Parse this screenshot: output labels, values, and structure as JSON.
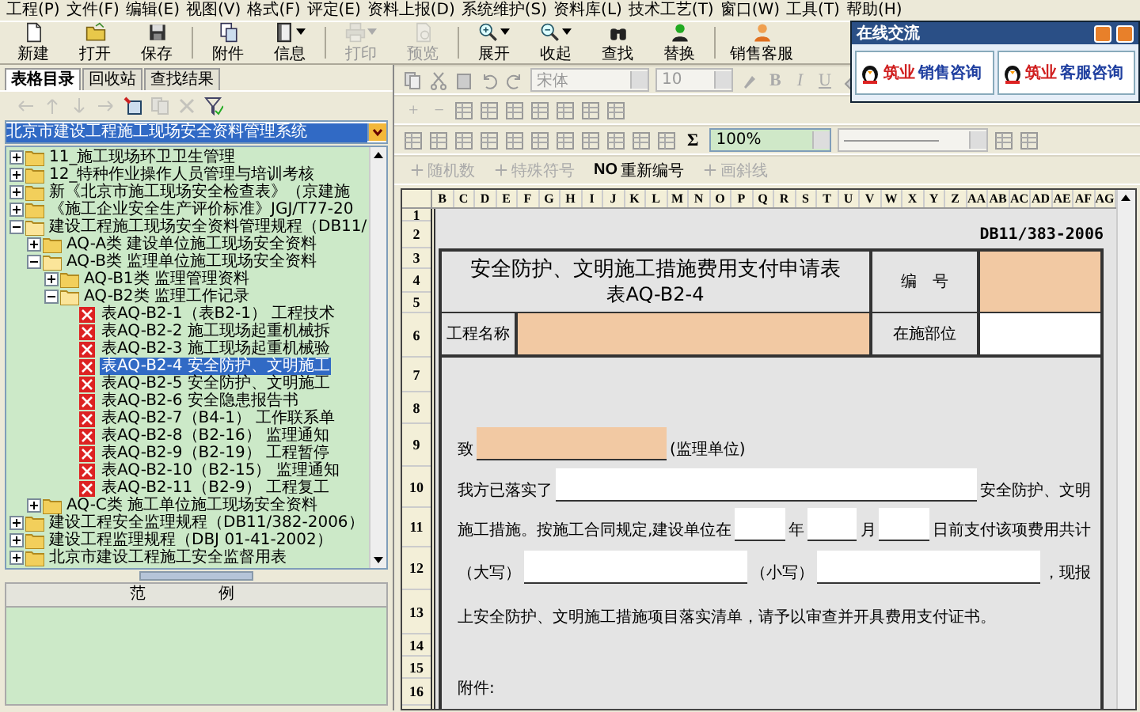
{
  "menu": [
    "工程(P)",
    "文件(F)",
    "编辑(E)",
    "视图(V)",
    "格式(F)",
    "评定(E)",
    "资料上报(D)",
    "系统维护(S)",
    "资料库(L)",
    "技术工艺(T)",
    "窗口(W)",
    "工具(T)",
    "帮助(H)"
  ],
  "toolbar": {
    "buttons": [
      {
        "label": "新建",
        "disabled": false,
        "has_menu": false
      },
      {
        "label": "打开",
        "disabled": false,
        "has_menu": false
      },
      {
        "label": "保存",
        "disabled": false,
        "has_menu": false
      },
      {
        "label": "附件",
        "disabled": false,
        "has_menu": false
      },
      {
        "label": "信息",
        "disabled": false,
        "has_menu": true
      },
      {
        "label": "打印",
        "disabled": true,
        "has_menu": true
      },
      {
        "label": "预览",
        "disabled": true,
        "has_menu": false
      },
      {
        "label": "展开",
        "disabled": false,
        "has_menu": true
      },
      {
        "label": "收起",
        "disabled": false,
        "has_menu": true
      },
      {
        "label": "查找",
        "disabled": false,
        "has_menu": false
      },
      {
        "label": "替换",
        "disabled": false,
        "has_menu": false
      },
      {
        "label": "销售客服",
        "disabled": false,
        "has_menu": false
      }
    ]
  },
  "chat_window": {
    "title": "在线交流",
    "buttons": [
      {
        "brand": "筑业",
        "label": "销售咨询"
      },
      {
        "brand": "筑业",
        "label": "客服咨询"
      }
    ]
  },
  "left_panel": {
    "tabs": [
      {
        "label": "表格目录",
        "selected": true
      },
      {
        "label": "回收站",
        "selected": false
      },
      {
        "label": "查找结果",
        "selected": false
      }
    ],
    "tree_toolbar": [
      {
        "disabled": true
      },
      {
        "disabled": true
      },
      {
        "disabled": true
      },
      {
        "disabled": true
      },
      {
        "disabled": false
      },
      {
        "disabled": true
      },
      {
        "disabled": true
      },
      {
        "disabled": false
      }
    ],
    "system_select": {
      "value": "北京市建设工程施工现场安全资料管理系统"
    },
    "tree": [
      {
        "kind": "folder",
        "label": "11_施工现场环卫卫生管理",
        "expanded": false,
        "selected": false
      },
      {
        "kind": "folder",
        "label": "12_特种作业操作人员管理与培训考核",
        "expanded": false,
        "selected": false
      },
      {
        "kind": "folder",
        "label": "新《北京市施工现场安全检查表》（京建施",
        "expanded": false,
        "selected": false
      },
      {
        "kind": "folder",
        "label": "《施工企业安全生产评价标准》JGJ/T77-20",
        "expanded": false,
        "selected": false
      },
      {
        "kind": "folder",
        "label": "建设工程施工现场安全资料管理规程（DB11/",
        "expanded": true,
        "selected": false,
        "children": [
          {
            "kind": "folder",
            "label": "AQ-A类 建设单位施工现场安全资料",
            "expanded": false,
            "selected": false
          },
          {
            "kind": "folder",
            "label": "AQ-B类 监理单位施工现场安全资料",
            "expanded": true,
            "selected": false,
            "children": [
              {
                "kind": "folder",
                "label": "AQ-B1类 监理管理资料",
                "expanded": false,
                "selected": false
              },
              {
                "kind": "folder",
                "label": "AQ-B2类 监理工作记录",
                "expanded": true,
                "selected": false,
                "children": [
                  {
                    "kind": "form",
                    "label": "表AQ-B2-1（表B2-1） 工程技术",
                    "selected": false
                  },
                  {
                    "kind": "form",
                    "label": "表AQ-B2-2 施工现场起重机械拆",
                    "selected": false
                  },
                  {
                    "kind": "form",
                    "label": "表AQ-B2-3 施工现场起重机械验",
                    "selected": false
                  },
                  {
                    "kind": "form",
                    "label": "表AQ-B2-4 安全防护、文明施工",
                    "selected": true
                  },
                  {
                    "kind": "form",
                    "label": "表AQ-B2-5 安全防护、文明施工",
                    "selected": false
                  },
                  {
                    "kind": "form",
                    "label": "表AQ-B2-6 安全隐患报告书",
                    "selected": false
                  },
                  {
                    "kind": "form",
                    "label": "表AQ-B2-7（B4-1） 工作联系单",
                    "selected": false
                  },
                  {
                    "kind": "form",
                    "label": "表AQ-B2-8（B2-16） 监理通知",
                    "selected": false
                  },
                  {
                    "kind": "form",
                    "label": "表AQ-B2-9（B2-19） 工程暂停",
                    "selected": false
                  },
                  {
                    "kind": "form",
                    "label": "表AQ-B2-10（B2-15） 监理通知",
                    "selected": false
                  },
                  {
                    "kind": "form",
                    "label": "表AQ-B2-11（B2-9） 工程复工",
                    "selected": false
                  }
                ]
              }
            ]
          },
          {
            "kind": "folder",
            "label": "AQ-C类 施工单位施工现场安全资料",
            "expanded": false,
            "selected": false
          }
        ]
      },
      {
        "kind": "folder",
        "label": "建设工程安全监理规程（DB11/382-2006）",
        "expanded": false,
        "selected": false
      },
      {
        "kind": "folder",
        "label": "建设工程监理规程（DBJ 01-41-2002）",
        "expanded": false,
        "selected": false
      },
      {
        "kind": "folder",
        "label": "北京市建设工程施工安全监督用表",
        "expanded": false,
        "selected": false
      }
    ],
    "example_panel": {
      "title": "范　例"
    }
  },
  "format_toolbar": {
    "font": {
      "value": "宋体",
      "disabled": true
    },
    "size": {
      "value": "10",
      "disabled": true
    },
    "style_buttons": [
      {
        "label": "B",
        "disabled": true
      },
      {
        "label": "I",
        "disabled": true
      },
      {
        "label": "U",
        "disabled": true
      }
    ]
  },
  "edit_toolbar": {
    "buttons": [
      {
        "label": "+",
        "disabled": true
      },
      {
        "label": "−",
        "disabled": true
      }
    ]
  },
  "layout_toolbar": {
    "sum": {
      "label": "Σ"
    },
    "zoom": {
      "value": "100%"
    }
  },
  "tools_toolbar": [
    {
      "label": "随机数",
      "disabled": true
    },
    {
      "label": "特殊符号",
      "disabled": true
    },
    {
      "label": "重新编号",
      "icon_text": "NO",
      "disabled": false
    },
    {
      "label": "画斜线",
      "disabled": true
    }
  ],
  "sheet": {
    "columns": [
      "B",
      "C",
      "D",
      "E",
      "F",
      "G",
      "H",
      "I",
      "J",
      "K",
      "L",
      "M",
      "N",
      "O",
      "P",
      "Q",
      "R",
      "S",
      "T",
      "U",
      "V",
      "W",
      "X",
      "Y",
      "Z",
      "AA",
      "AB",
      "AC",
      "AD",
      "AE",
      "AF",
      "AG"
    ],
    "row_numbers": [
      "1",
      "2",
      "3",
      "4",
      "5",
      "6",
      "7",
      "8",
      "9",
      "10",
      "11",
      "12",
      "13",
      "14",
      "15",
      "16"
    ],
    "standard": "DB11/383-2006",
    "title": "安全防护、文明施工措施费用支付申请表",
    "subtitle": "表AQ-B2-4",
    "number_label": "编　号",
    "number_field": {
      "required": true
    },
    "project_label": "工程名称",
    "project_field": {
      "required": true
    },
    "location_label": "在施部位",
    "location_field": {
      "required": false
    },
    "body_lines": [
      {
        "segments": [
          {
            "kind": "text",
            "text": "致"
          },
          {
            "kind": "field",
            "required": true
          },
          {
            "kind": "text",
            "text": "(监理单位)"
          }
        ]
      },
      {
        "segments": [
          {
            "kind": "text",
            "text": "我方已落实了"
          },
          {
            "kind": "field",
            "required": false
          },
          {
            "kind": "text",
            "text": "安全防护、文明"
          }
        ]
      },
      {
        "segments": [
          {
            "kind": "text",
            "text": "施工措施。按施工合同规定,建设单位在"
          },
          {
            "kind": "field",
            "required": false
          },
          {
            "kind": "text",
            "text": "年"
          },
          {
            "kind": "field",
            "required": false
          },
          {
            "kind": "text",
            "text": "月"
          },
          {
            "kind": "field",
            "required": false
          },
          {
            "kind": "text",
            "text": "日前支付该项费用共计"
          }
        ]
      },
      {
        "segments": [
          {
            "kind": "text",
            "text": "（大写）"
          },
          {
            "kind": "field",
            "required": false
          },
          {
            "kind": "text",
            "text": "（小写）"
          },
          {
            "kind": "field",
            "required": false
          },
          {
            "kind": "text",
            "text": "，现报"
          }
        ]
      },
      {
        "segments": [
          {
            "kind": "text",
            "text": "上安全防护、文明施工措施项目落实清单，请予以审查并开具费用支付证书。"
          }
        ]
      },
      {
        "segments": [
          {
            "kind": "text",
            "text": "附件:"
          }
        ]
      }
    ]
  }
}
